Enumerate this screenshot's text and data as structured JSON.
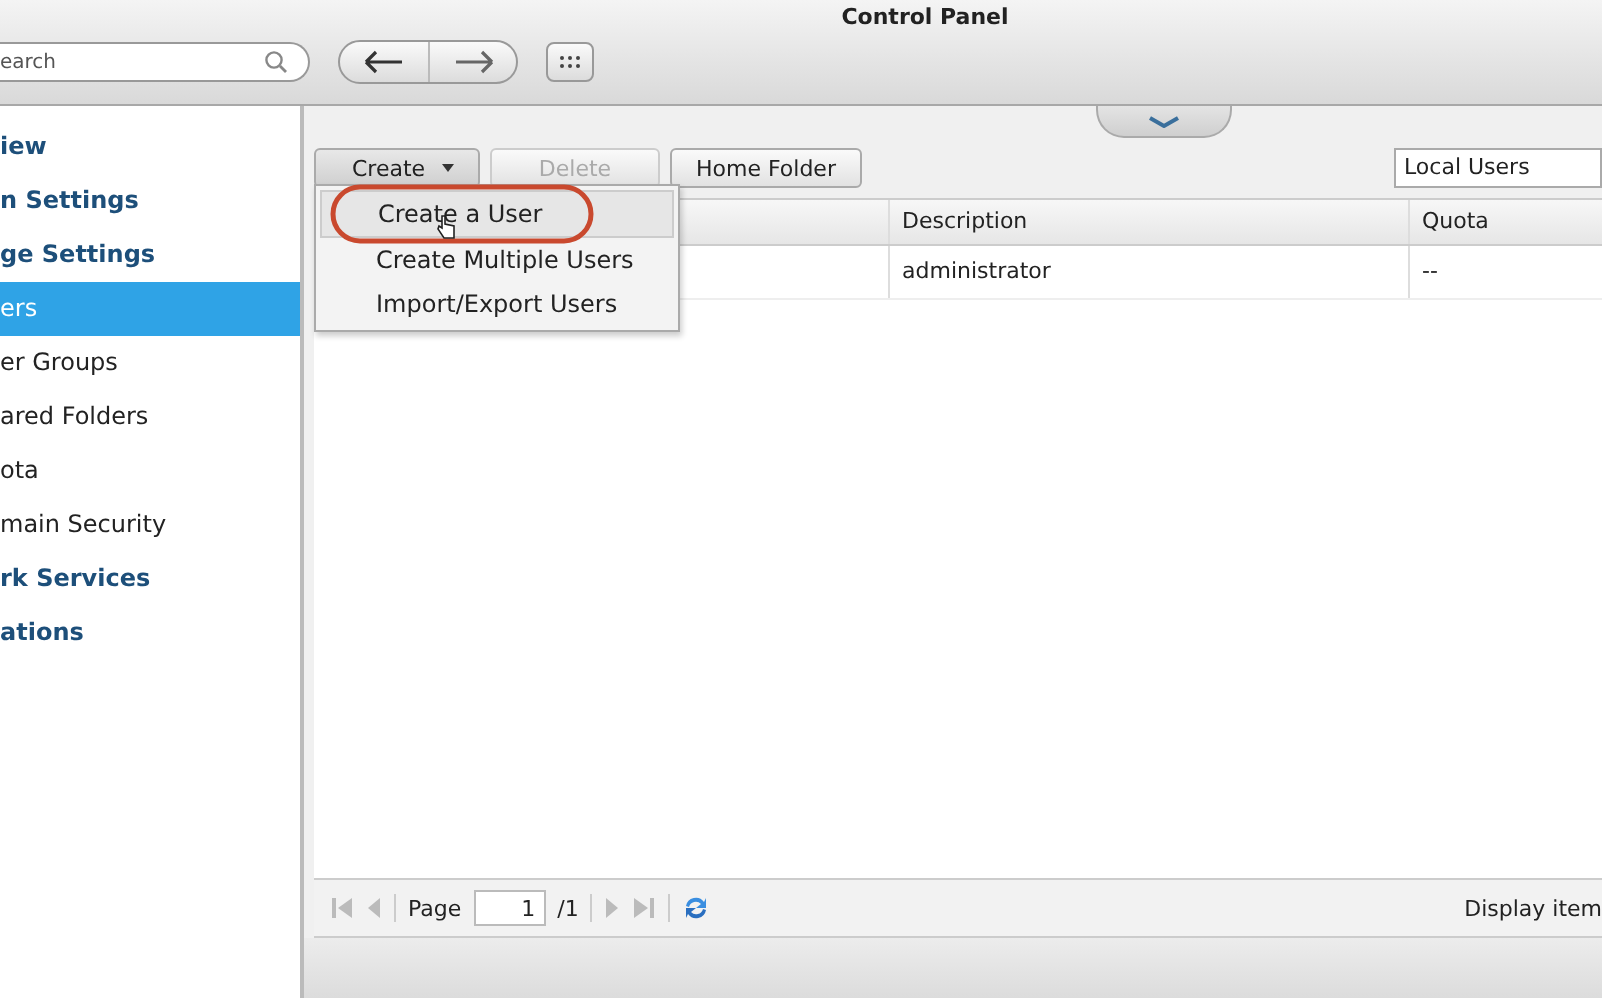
{
  "window": {
    "title": "Control Panel"
  },
  "search": {
    "placeholder": "earch"
  },
  "sidebar": {
    "items": [
      {
        "label": "iew",
        "kind": "category",
        "selected": false
      },
      {
        "label": "n Settings",
        "kind": "category",
        "selected": false
      },
      {
        "label": "ge Settings",
        "kind": "category",
        "selected": false
      },
      {
        "label": "ers",
        "kind": "item",
        "selected": true
      },
      {
        "label": "er Groups",
        "kind": "item",
        "selected": false
      },
      {
        "label": "ared Folders",
        "kind": "item",
        "selected": false
      },
      {
        "label": "ota",
        "kind": "item",
        "selected": false
      },
      {
        "label": "main Security",
        "kind": "item",
        "selected": false
      },
      {
        "label": "rk Services",
        "kind": "category",
        "selected": false
      },
      {
        "label": "ations",
        "kind": "category",
        "selected": false
      }
    ]
  },
  "toolbar": {
    "buttons": [
      {
        "label": "Create",
        "dropdown": true,
        "disabled": false
      },
      {
        "label": "Delete",
        "dropdown": false,
        "disabled": true
      },
      {
        "label": "Home Folder",
        "dropdown": false,
        "disabled": false
      }
    ],
    "filter": {
      "value": "Local Users"
    }
  },
  "menu": {
    "items": [
      {
        "label": "Create a User",
        "selected": true
      },
      {
        "label": "Create Multiple Users",
        "selected": false
      },
      {
        "label": "Import/Export Users",
        "selected": false
      }
    ]
  },
  "table": {
    "columns": [
      "",
      "Description",
      "Quota"
    ],
    "rows": [
      [
        "",
        "administrator",
        "--"
      ]
    ]
  },
  "pagination": {
    "page_label": "Page",
    "page": "1",
    "total": "/1",
    "display": "Display item"
  }
}
